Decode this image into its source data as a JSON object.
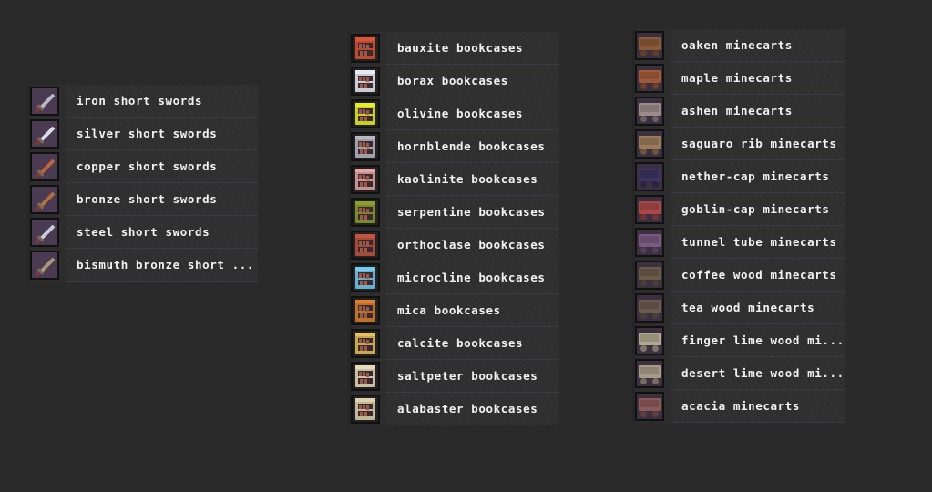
{
  "panels": {
    "swords": {
      "items": [
        {
          "label": "iron short swords",
          "icon": "short-sword-icon",
          "color": "#b8b8c0"
        },
        {
          "label": "silver short swords",
          "icon": "short-sword-icon",
          "color": "#d8dce4"
        },
        {
          "label": "copper short swords",
          "icon": "short-sword-icon",
          "color": "#c0643a"
        },
        {
          "label": "bronze short swords",
          "icon": "short-sword-icon",
          "color": "#b07040"
        },
        {
          "label": "steel short swords",
          "icon": "short-sword-icon",
          "color": "#c8ccd8"
        },
        {
          "label": "bismuth bronze short ...",
          "icon": "short-sword-icon",
          "color": "#a89878"
        }
      ]
    },
    "bookcases": {
      "items": [
        {
          "label": "bauxite bookcases",
          "icon": "bookcase-icon",
          "color": "#c04a2e"
        },
        {
          "label": "borax bookcases",
          "icon": "bookcase-icon",
          "color": "#c8ccd4"
        },
        {
          "label": "olivine bookcases",
          "icon": "bookcase-icon",
          "color": "#c8d020"
        },
        {
          "label": "hornblende bookcases",
          "icon": "bookcase-icon",
          "color": "#a0a0a8"
        },
        {
          "label": "kaolinite bookcases",
          "icon": "bookcase-icon",
          "color": "#c89090"
        },
        {
          "label": "serpentine bookcases",
          "icon": "bookcase-icon",
          "color": "#7a8a28"
        },
        {
          "label": "orthoclase bookcases",
          "icon": "bookcase-icon",
          "color": "#a84a38"
        },
        {
          "label": "microcline bookcases",
          "icon": "bookcase-icon",
          "color": "#68b0d0"
        },
        {
          "label": "mica bookcases",
          "icon": "bookcase-icon",
          "color": "#c07028"
        },
        {
          "label": "calcite bookcases",
          "icon": "bookcase-icon",
          "color": "#c8a850"
        },
        {
          "label": "saltpeter bookcases",
          "icon": "bookcase-icon",
          "color": "#c8c0a0"
        },
        {
          "label": "alabaster bookcases",
          "icon": "bookcase-icon",
          "color": "#c0b898"
        }
      ]
    },
    "minecarts": {
      "items": [
        {
          "label": "oaken minecarts",
          "icon": "minecart-icon",
          "color": "#8a5a38"
        },
        {
          "label": "maple minecarts",
          "icon": "minecart-icon",
          "color": "#a05a3a"
        },
        {
          "label": "ashen minecarts",
          "icon": "minecart-icon",
          "color": "#9a8a88"
        },
        {
          "label": "saguaro rib minecarts",
          "icon": "minecart-icon",
          "color": "#9a7a58"
        },
        {
          "label": "nether-cap minecarts",
          "icon": "minecart-icon",
          "color": "#3a3460"
        },
        {
          "label": "goblin-cap minecarts",
          "icon": "minecart-icon",
          "color": "#a84848"
        },
        {
          "label": "tunnel tube minecarts",
          "icon": "minecart-icon",
          "color": "#7a5a80"
        },
        {
          "label": "coffee wood minecarts",
          "icon": "minecart-icon",
          "color": "#6a5a4a"
        },
        {
          "label": "tea wood minecarts",
          "icon": "minecart-icon",
          "color": "#6a5a50"
        },
        {
          "label": "finger lime wood mi...",
          "icon": "minecart-icon",
          "color": "#b0a890"
        },
        {
          "label": "desert lime wood mi...",
          "icon": "minecart-icon",
          "color": "#a89a88"
        },
        {
          "label": "acacia minecarts",
          "icon": "minecart-icon",
          "color": "#8a5a58"
        }
      ]
    }
  }
}
